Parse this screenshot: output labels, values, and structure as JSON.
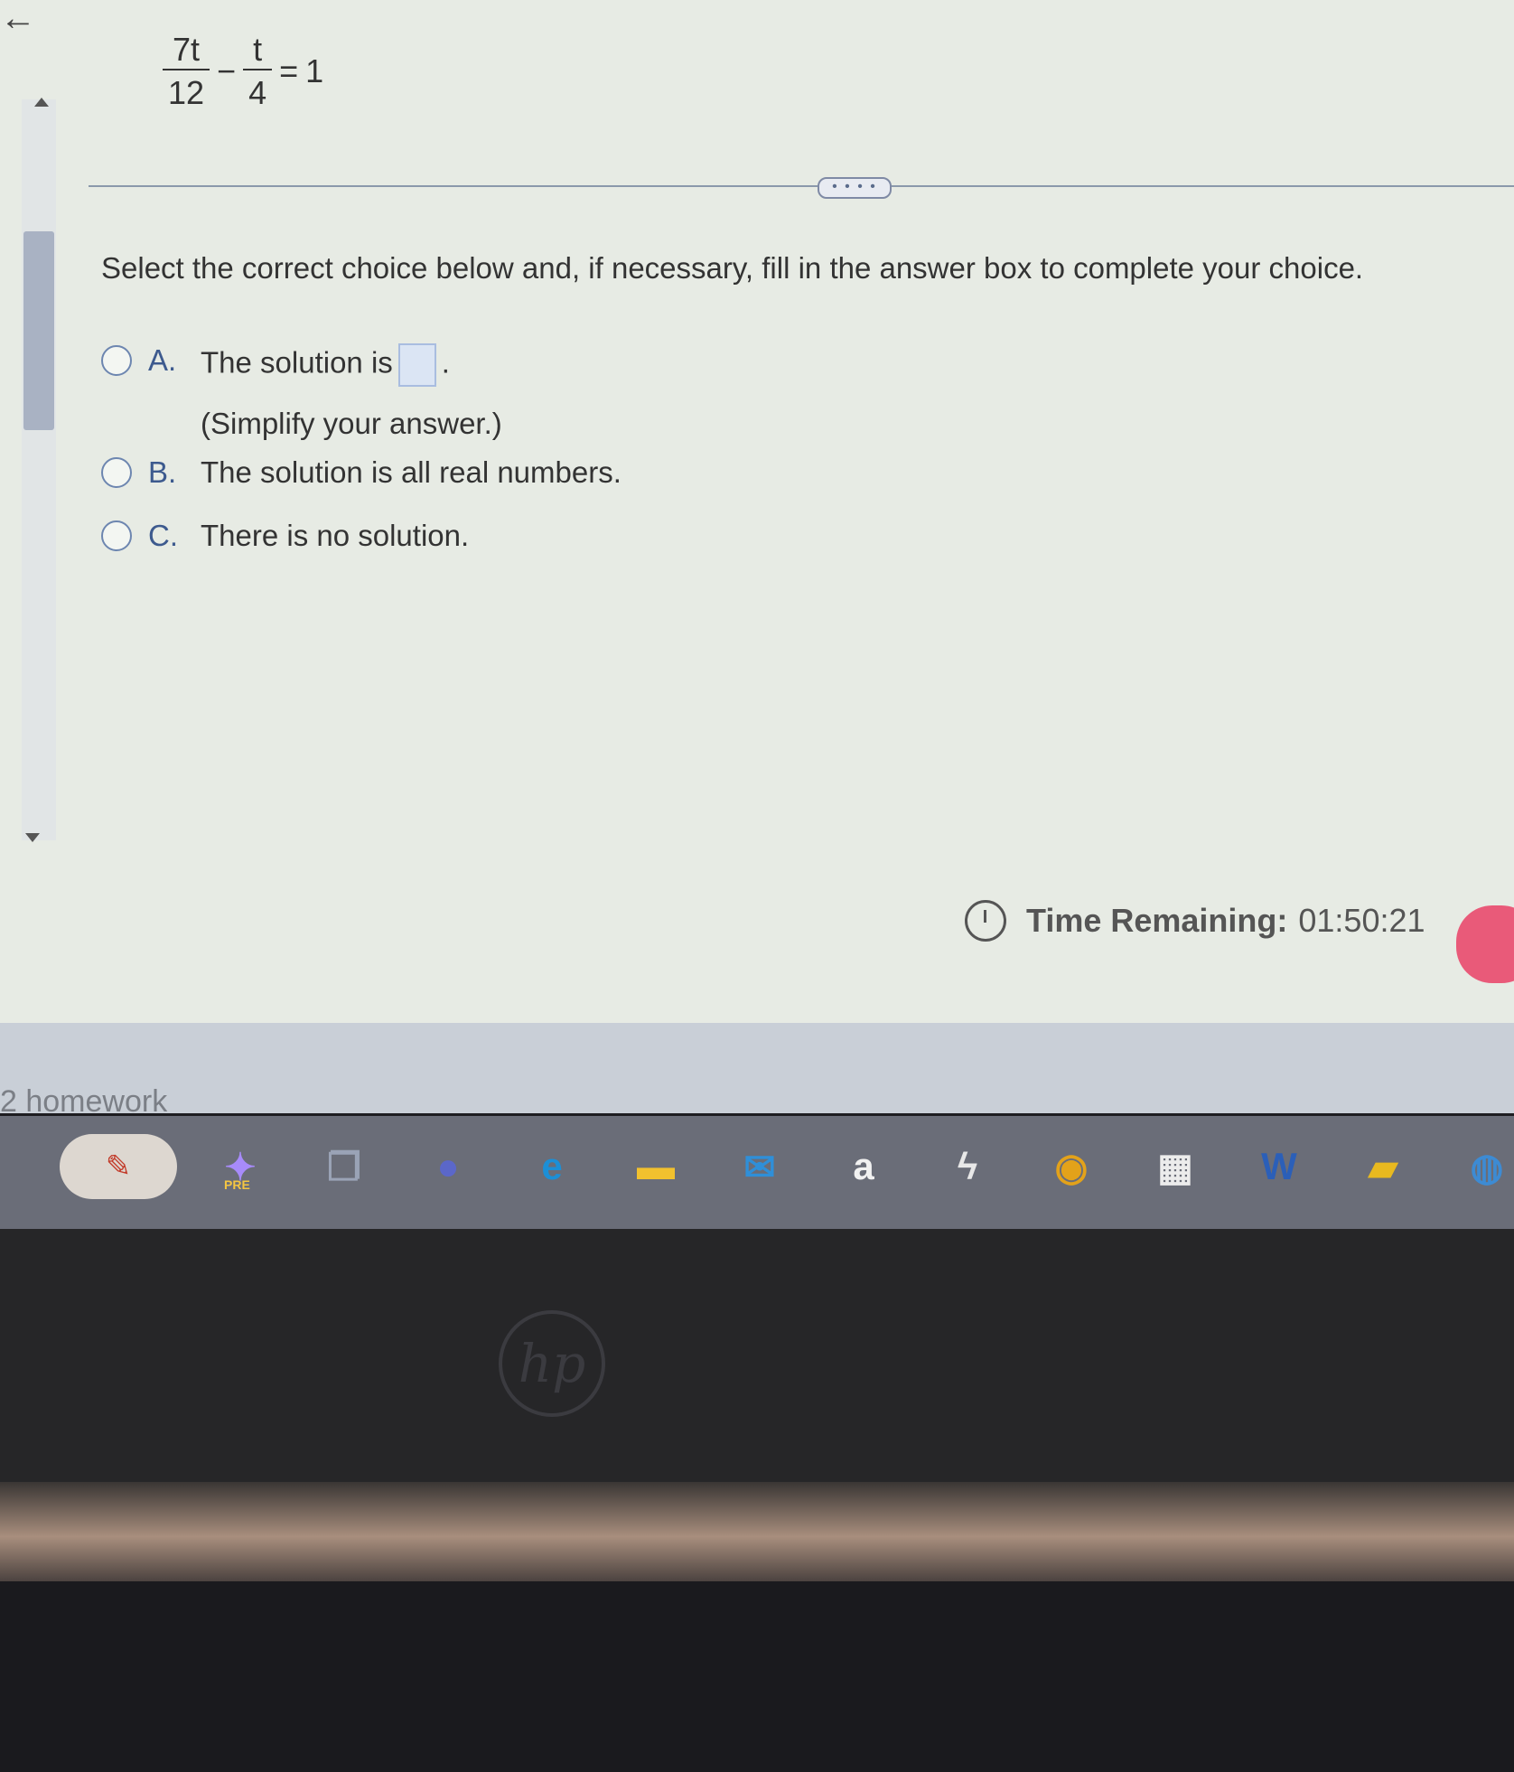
{
  "question": {
    "equation": {
      "term1_num": "7t",
      "term1_den": "12",
      "operator": "−",
      "term2_num": "t",
      "term2_den": "4",
      "equals": "=",
      "rhs": "1"
    },
    "divider_handle": "• • • •",
    "instruction": "Select the correct choice below and, if necessary, fill in the answer box to complete your choice."
  },
  "choices": [
    {
      "letter": "A.",
      "text": "The solution is",
      "after_box": ".",
      "sub": "(Simplify your answer.)"
    },
    {
      "letter": "B.",
      "text": "The solution is all real numbers."
    },
    {
      "letter": "C.",
      "text": "There is no solution."
    }
  ],
  "timer": {
    "label": "Time Remaining:",
    "value": "01:50:21"
  },
  "footer": {
    "homework_label": "2 homework"
  },
  "taskbar": [
    {
      "name": "copilot-icon",
      "glyph": "✦",
      "color": "#a78bfa",
      "badge": "PRE"
    },
    {
      "name": "task-view-icon",
      "glyph": "❐",
      "color": "#9aa3b6"
    },
    {
      "name": "video-call-icon",
      "glyph": "●",
      "color": "#5b67c9"
    },
    {
      "name": "edge-icon",
      "glyph": "e",
      "color": "#1c8fd6"
    },
    {
      "name": "file-explorer-icon",
      "glyph": "▬",
      "color": "#f2c12e"
    },
    {
      "name": "mail-icon",
      "glyph": "✉",
      "color": "#2f8fd8"
    },
    {
      "name": "amazon-icon",
      "glyph": "a",
      "color": "#f1f1f1"
    },
    {
      "name": "lightning-app-icon",
      "glyph": "ϟ",
      "color": "#e8e8e8"
    },
    {
      "name": "chrome-icon",
      "glyph": "◉",
      "color": "#e3a21a"
    },
    {
      "name": "store-icon",
      "glyph": "▦",
      "color": "#ececec"
    },
    {
      "name": "word-icon",
      "glyph": "W",
      "color": "#2b5fb8"
    },
    {
      "name": "sticky-notes-icon",
      "glyph": "▰",
      "color": "#e8b91f"
    },
    {
      "name": "app-icon",
      "glyph": "◍",
      "color": "#3d8bd3"
    }
  ],
  "device": {
    "logo": "hp"
  }
}
